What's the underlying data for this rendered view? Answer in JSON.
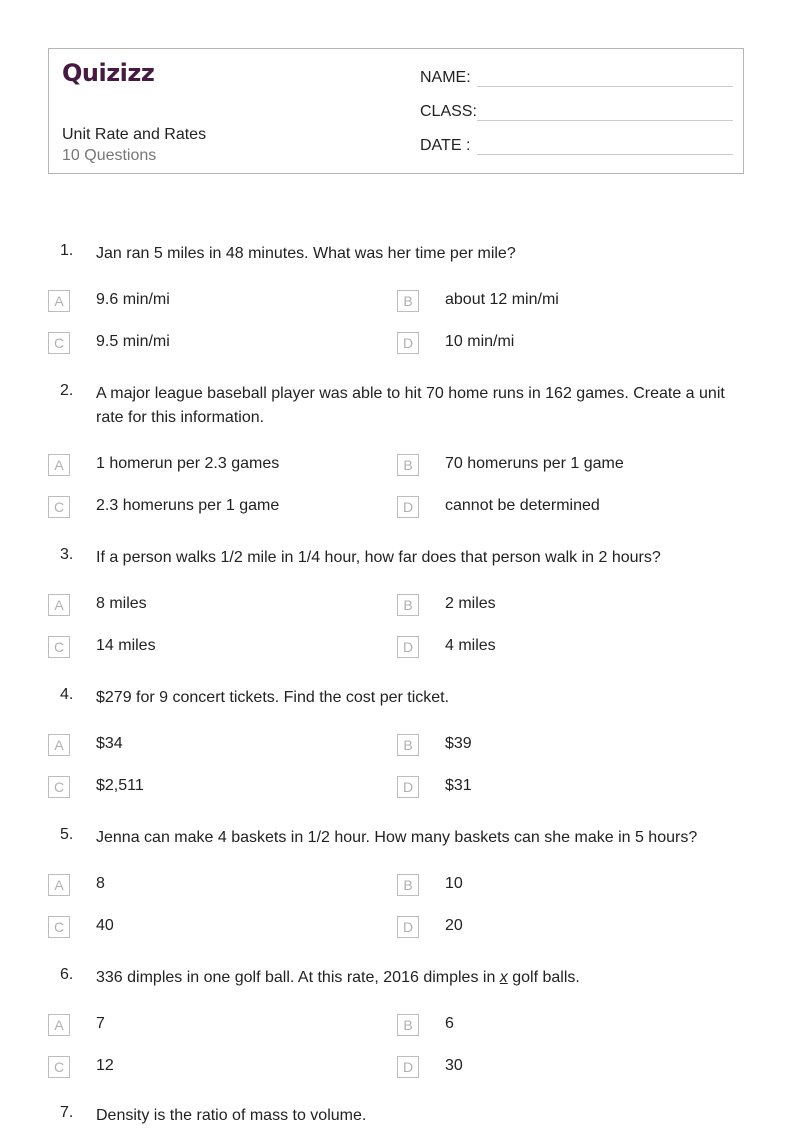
{
  "header": {
    "logo": "Quizizz",
    "title": "Unit Rate and Rates",
    "question_count": "10 Questions",
    "fields": [
      {
        "label": "NAME",
        "sep": ":"
      },
      {
        "label": "CLASS",
        "sep": ":"
      },
      {
        "label": "DATE",
        "sep": ":"
      }
    ]
  },
  "questions": [
    {
      "number": "1.",
      "text": "Jan ran 5 miles in 48 minutes. What was her time per mile?",
      "options": [
        {
          "letter": "A",
          "text": "9.6 min/mi"
        },
        {
          "letter": "B",
          "text": "about 12 min/mi"
        },
        {
          "letter": "C",
          "text": "9.5 min/mi"
        },
        {
          "letter": "D",
          "text": "10 min/mi"
        }
      ]
    },
    {
      "number": "2.",
      "text": "A major league baseball player was able to hit 70 home runs in 162 games. Create a unit rate for this information.",
      "options": [
        {
          "letter": "A",
          "text": "1 homerun per 2.3 games"
        },
        {
          "letter": "B",
          "text": "70 homeruns per 1 game"
        },
        {
          "letter": "C",
          "text": "2.3 homeruns per 1 game"
        },
        {
          "letter": "D",
          "text": "cannot be determined"
        }
      ]
    },
    {
      "number": "3.",
      "text": "If a person walks 1/2 mile in 1/4 hour, how far does that person walk in 2 hours?",
      "options": [
        {
          "letter": "A",
          "text": "8 miles"
        },
        {
          "letter": "B",
          "text": "2 miles"
        },
        {
          "letter": "C",
          "text": "14 miles"
        },
        {
          "letter": "D",
          "text": "4 miles"
        }
      ]
    },
    {
      "number": "4.",
      "text": "$279 for 9 concert tickets. Find the cost per ticket.",
      "options": [
        {
          "letter": "A",
          "text": "$34"
        },
        {
          "letter": "B",
          "text": "$39"
        },
        {
          "letter": "C",
          "text": "$2,511"
        },
        {
          "letter": "D",
          "text": "$31"
        }
      ]
    },
    {
      "number": "5.",
      "text": "Jenna can make 4 baskets in 1/2 hour. How many baskets can she make in 5 hours?",
      "options": [
        {
          "letter": "A",
          "text": "8"
        },
        {
          "letter": "B",
          "text": "10"
        },
        {
          "letter": "C",
          "text": "40"
        },
        {
          "letter": "D",
          "text": "20"
        }
      ]
    },
    {
      "number": "6.",
      "text_before": "336 dimples in one golf ball. At this rate, 2016 dimples in ",
      "text_var": "x",
      "text_after": " golf balls.",
      "options": [
        {
          "letter": "A",
          "text": "7"
        },
        {
          "letter": "B",
          "text": "6"
        },
        {
          "letter": "C",
          "text": "12"
        },
        {
          "letter": "D",
          "text": "30"
        }
      ]
    },
    {
      "number": "7.",
      "text": "Density is the ratio of mass to volume."
    }
  ]
}
